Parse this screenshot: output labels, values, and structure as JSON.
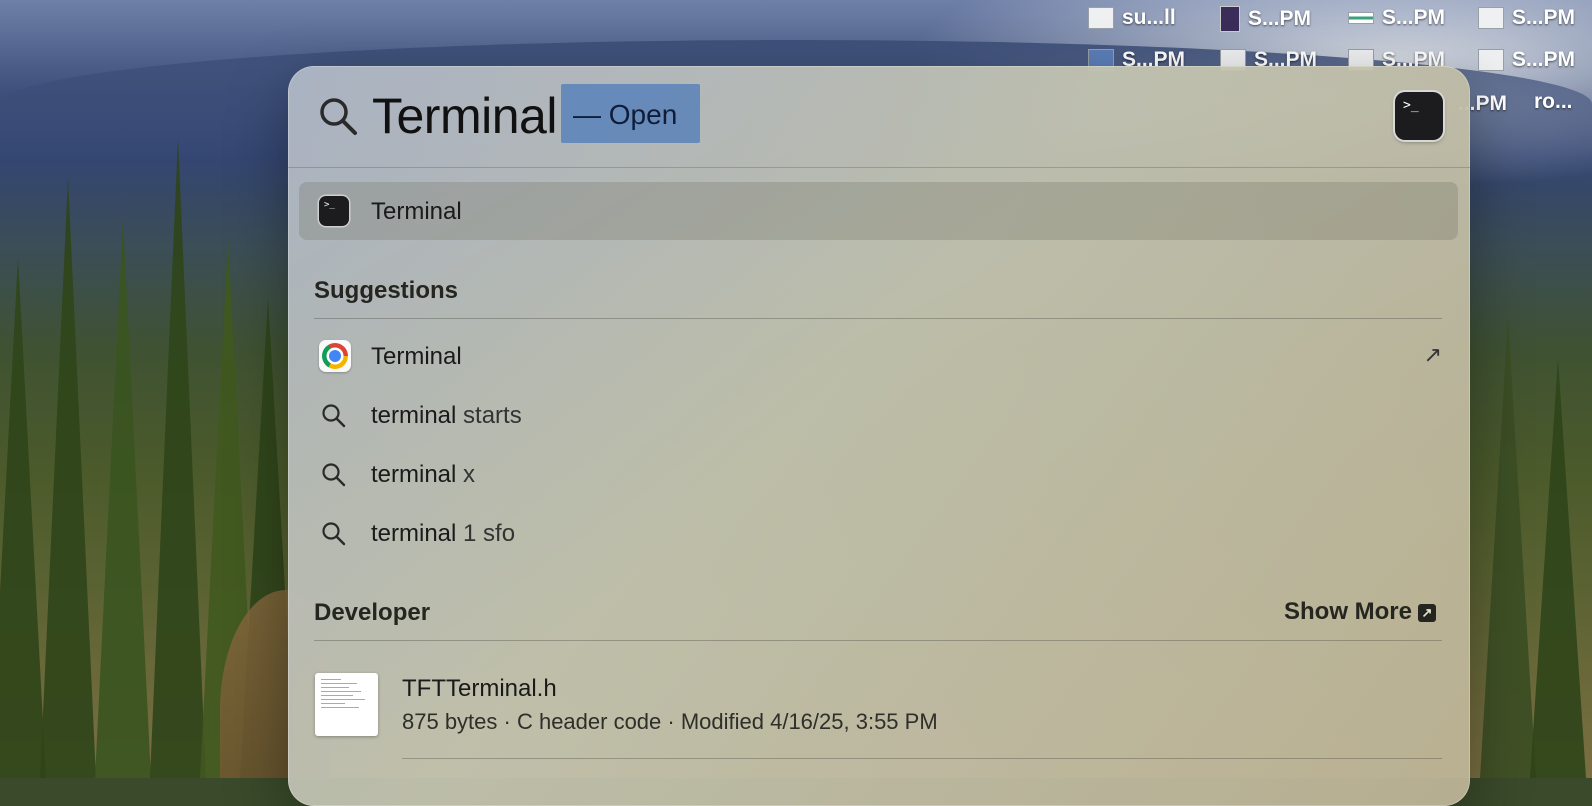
{
  "desktop": {
    "items": [
      {
        "label": "su...ll",
        "thumb": "plain"
      },
      {
        "label": "S...PM",
        "thumb": "dark"
      },
      {
        "label": "S...PM",
        "thumb": "green"
      },
      {
        "label": "S...PM",
        "thumb": "plain"
      },
      {
        "label": "S...PM",
        "thumb": "blue"
      },
      {
        "label": "S...PM",
        "thumb": "plain"
      },
      {
        "label": "S...PM",
        "thumb": "plain"
      },
      {
        "label": "S...PM",
        "thumb": "plain"
      },
      {
        "label": "...PM",
        "thumb": "none"
      },
      {
        "label": "ro...",
        "thumb": "none"
      }
    ]
  },
  "spotlight": {
    "query": "Terminal",
    "completion": "— Open",
    "preview_icon": "terminal-app-icon",
    "top_hit": {
      "label": "Terminal",
      "icon": "terminal-app-icon"
    },
    "suggestions": {
      "title": "Suggestions",
      "items": [
        {
          "type": "web",
          "icon": "chrome-icon",
          "bold": "Terminal",
          "rest": "",
          "action_icon": "arrow-up-right-icon"
        },
        {
          "type": "search",
          "icon": "search-icon",
          "bold": "terminal",
          "rest": " starts"
        },
        {
          "type": "search",
          "icon": "search-icon",
          "bold": "terminal",
          "rest": " x"
        },
        {
          "type": "search",
          "icon": "search-icon",
          "bold": "terminal",
          "rest": " 1 sfo"
        }
      ]
    },
    "developer": {
      "title": "Developer",
      "show_more": "Show More",
      "file": {
        "name": "TFTTerminal.h",
        "meta": "875 bytes · C header code · Modified 4/16/25, 3:55 PM"
      }
    }
  },
  "colors": {
    "selection": "#4a78ba",
    "panel": "#c4c4b0",
    "text": "#1a1a1a"
  }
}
